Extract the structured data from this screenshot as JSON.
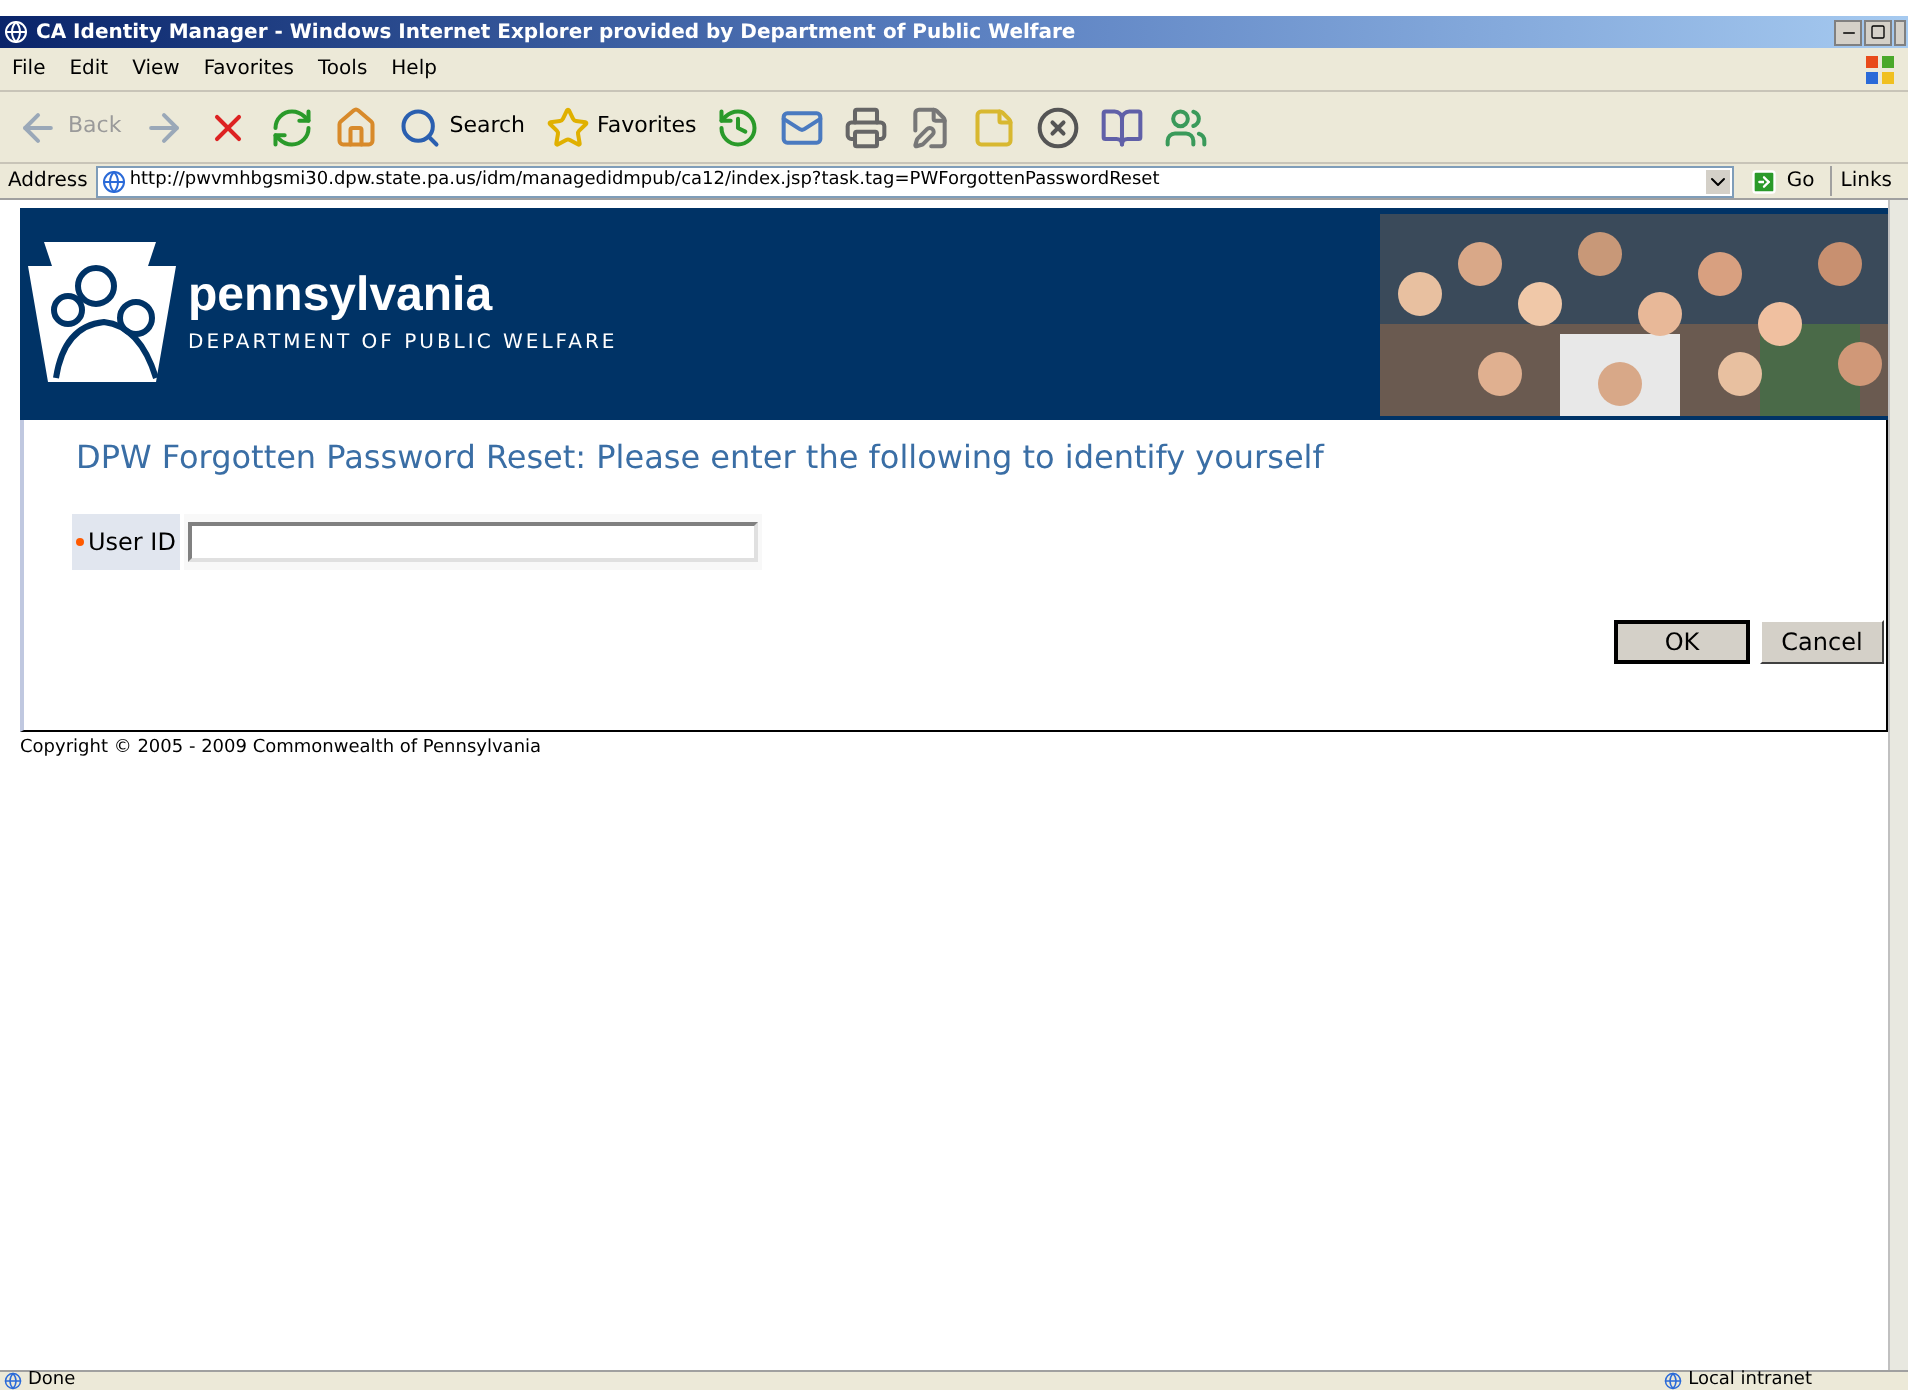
{
  "window": {
    "title": "CA Identity Manager - Windows Internet Explorer provided by Department of Public Welfare"
  },
  "menu": [
    "File",
    "Edit",
    "View",
    "Favorites",
    "Tools",
    "Help"
  ],
  "toolbar": [
    {
      "kind": "back",
      "label": "Back",
      "disabled": true
    },
    {
      "kind": "forward",
      "disabled": true
    },
    {
      "kind": "stop"
    },
    {
      "kind": "refresh"
    },
    {
      "kind": "home"
    },
    {
      "kind": "search",
      "label": "Search"
    },
    {
      "kind": "favorites",
      "label": "Favorites"
    },
    {
      "kind": "history"
    },
    {
      "kind": "mail"
    },
    {
      "kind": "print"
    },
    {
      "kind": "edit"
    },
    {
      "kind": "note"
    },
    {
      "kind": "block"
    },
    {
      "kind": "research"
    },
    {
      "kind": "messenger"
    }
  ],
  "address": {
    "label": "Address",
    "value": "http://pwvmhbgsmi30.dpw.state.pa.us/idm/managedidmpub/ca12/index.jsp?task.tag=PWForgottenPasswordReset",
    "go": "Go",
    "links": "Links"
  },
  "header": {
    "name": "pennsylvania",
    "department": "DEPARTMENT OF PUBLIC WELFARE"
  },
  "form": {
    "title": "DPW Forgotten Password Reset: Please enter the following to identify yourself",
    "fields": [
      {
        "label": "User ID",
        "required": true
      }
    ],
    "buttons": [
      "OK",
      "Cancel"
    ]
  },
  "footer": "Copyright © 2005 - 2009 Commonwealth of Pennsylvania",
  "status_bar": {
    "text": "Done",
    "zone": "Local intranet"
  }
}
